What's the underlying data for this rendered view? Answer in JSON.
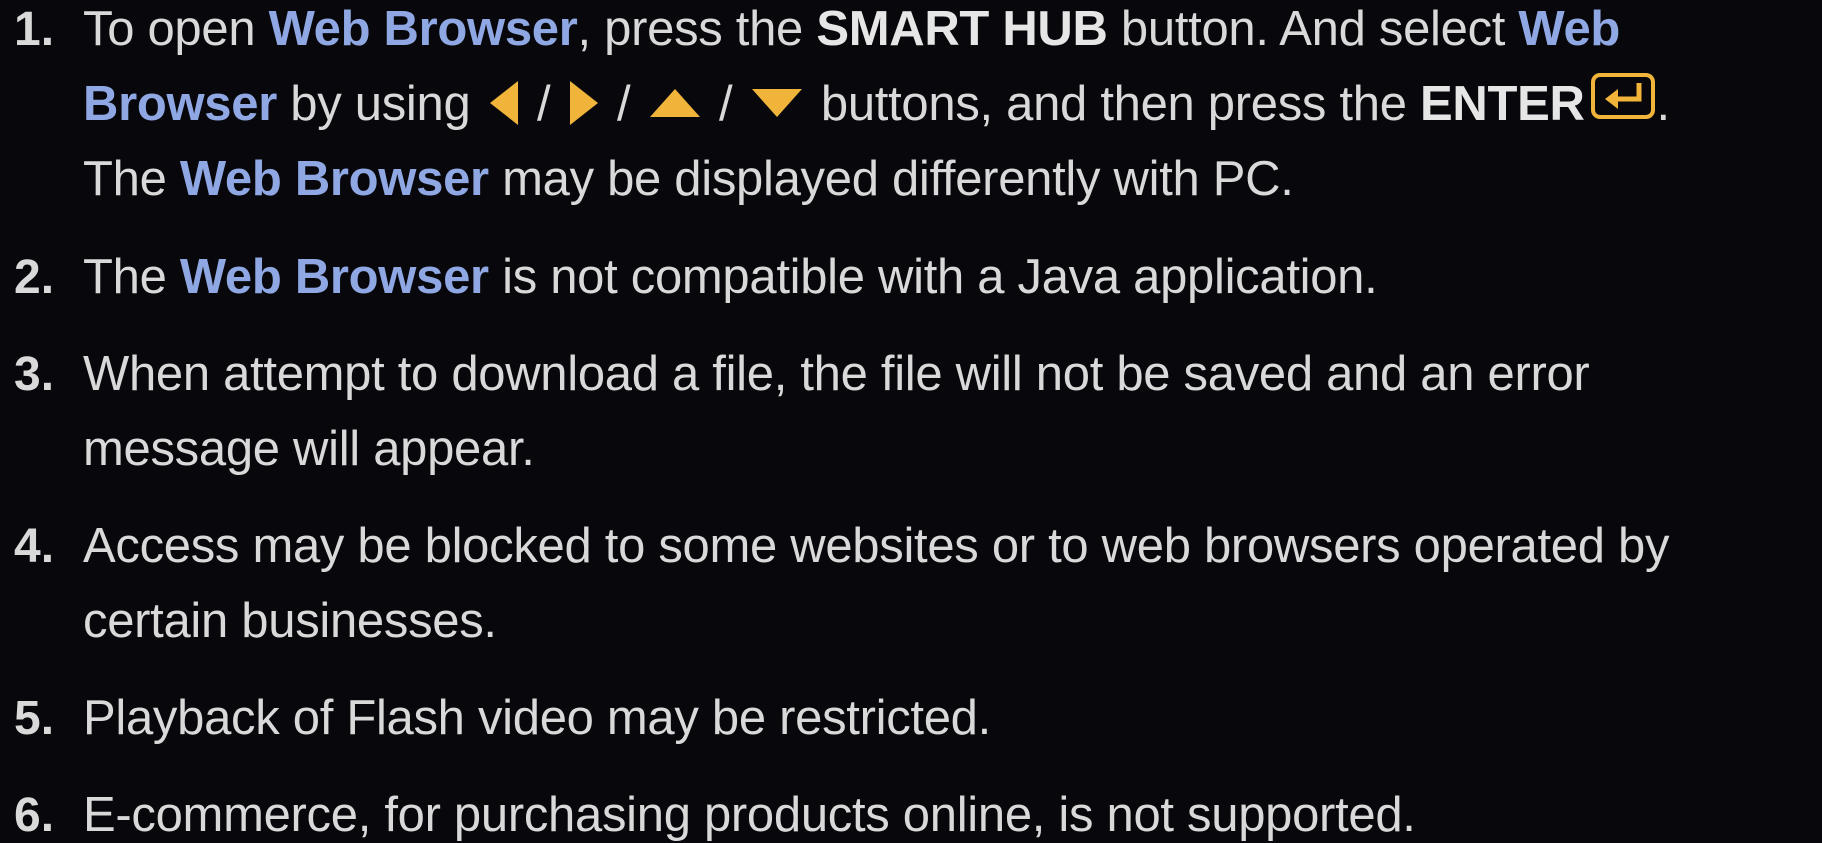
{
  "colors": {
    "background": "#08080c",
    "text": "#d9d9d9",
    "highlight": "#8fa8e4",
    "icon_accent": "#f0b43a"
  },
  "icons": {
    "left": "triangle-left",
    "right": "triangle-right",
    "up": "triangle-up",
    "down": "triangle-down",
    "enter": "enter-return"
  },
  "items": [
    {
      "number": "1.",
      "l1_a": "To open ",
      "l1_hl1": "Web Browser",
      "l1_b": ", press the ",
      "l1_bold": "SMART HUB",
      "l1_c": " button. And select ",
      "l1_hl2": "Web",
      "l2_hl": "Browser",
      "l2_a": " by using ",
      "sep1": " / ",
      "sep2": " / ",
      "sep3": " / ",
      "l2_b": " buttons, and then press the ",
      "l2_bold": "ENTER",
      "l2_end": ".",
      "l3_a": "The ",
      "l3_hl": "Web Browser",
      "l3_b": " may be displayed differently with PC."
    },
    {
      "number": "2.",
      "a": "The ",
      "hl": "Web Browser",
      "b": " is not compatible with a Java application."
    },
    {
      "number": "3.",
      "l1": "When attempt to download a file, the file will not be saved and an error",
      "l2": "message will appear."
    },
    {
      "number": "4.",
      "l1": "Access may be blocked to some websites or to web browsers operated by",
      "l2": "certain businesses."
    },
    {
      "number": "5.",
      "l1": "Playback of Flash video may be restricted."
    },
    {
      "number": "6.",
      "l1": "E-commerce, for purchasing products online, is not supported."
    }
  ]
}
